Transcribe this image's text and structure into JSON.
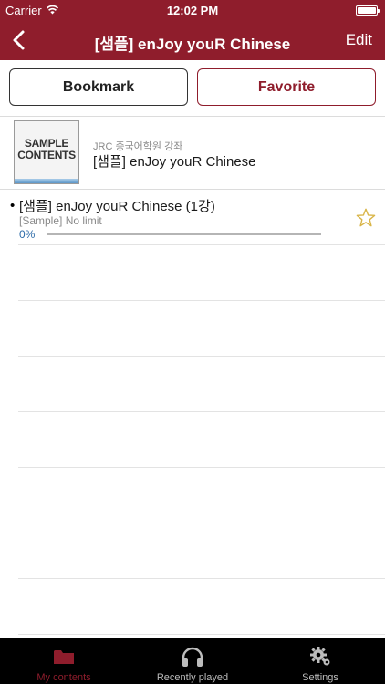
{
  "status_bar": {
    "carrier": "Carrier",
    "time": "12:02 PM"
  },
  "nav": {
    "title": "[샘플] enJoy youR Chinese",
    "edit_label": "Edit"
  },
  "segments": {
    "bookmark": "Bookmark",
    "favorite": "Favorite"
  },
  "content": {
    "thumbnail_text_line1": "SAMPLE",
    "thumbnail_text_line2": "CONTENTS",
    "subtitle": "JRC 중국어학원 강좌",
    "title": "[샘플] enJoy youR Chinese"
  },
  "lessons": [
    {
      "bullet": "•",
      "title": "[샘플] enJoy youR Chinese (1강)",
      "limit": "[Sample] No limit",
      "progress_label": "0%",
      "progress": 0.0,
      "favorite": false
    }
  ],
  "tabs": [
    {
      "label": "My contents",
      "icon": "folder-icon",
      "active": true
    },
    {
      "label": "Recently played",
      "icon": "headphones-icon",
      "active": false
    },
    {
      "label": "Settings",
      "icon": "gear-icon",
      "active": false
    }
  ],
  "colors": {
    "brand": "#8f1d2c",
    "progress": "#2b6aa8",
    "tab_bar": "#000000",
    "star": "#d9b548"
  }
}
